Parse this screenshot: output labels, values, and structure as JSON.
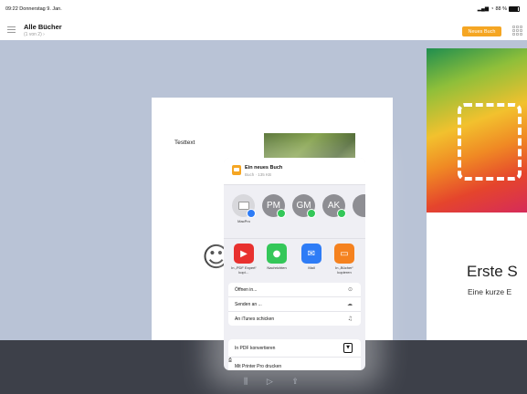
{
  "status": {
    "time": "09:22",
    "date": "Donnerstag 9. Jan.",
    "battery": "88 %",
    "battery_level": 0.88
  },
  "nav": {
    "title": "Alle Bücher",
    "subtitle": "(1 von 2) ›",
    "new_book": "Neues Buch"
  },
  "page": {
    "text": "Testtext",
    "book_title": "Erste S",
    "book_subtitle": "Eine kurze E"
  },
  "sheet": {
    "title": "Ein neues Buch",
    "subtitle": "Buch · 135 KB",
    "airdrop": [
      {
        "initials": "",
        "label": "MacPro"
      },
      {
        "initials": "PM",
        "label": ""
      },
      {
        "initials": "GM",
        "label": ""
      },
      {
        "initials": "AK",
        "label": ""
      }
    ],
    "apps": [
      {
        "label": "In „PDF Expert“ kopi…",
        "color": "#e8312f"
      },
      {
        "label": "Nachrichten",
        "color": "#34c759"
      },
      {
        "label": "Mail",
        "color": "#2e7cf6"
      },
      {
        "label": "In „Bücher“ kopieren",
        "color": "#f5821f"
      }
    ],
    "actions": [
      {
        "label": "Öffnen in..."
      },
      {
        "label": "Senden an ..."
      },
      {
        "label": "An iTunes schicken"
      }
    ],
    "actions2": [
      {
        "label": "In PDF konvertieren"
      },
      {
        "label": "Mit Printer Pro drucken"
      }
    ]
  }
}
